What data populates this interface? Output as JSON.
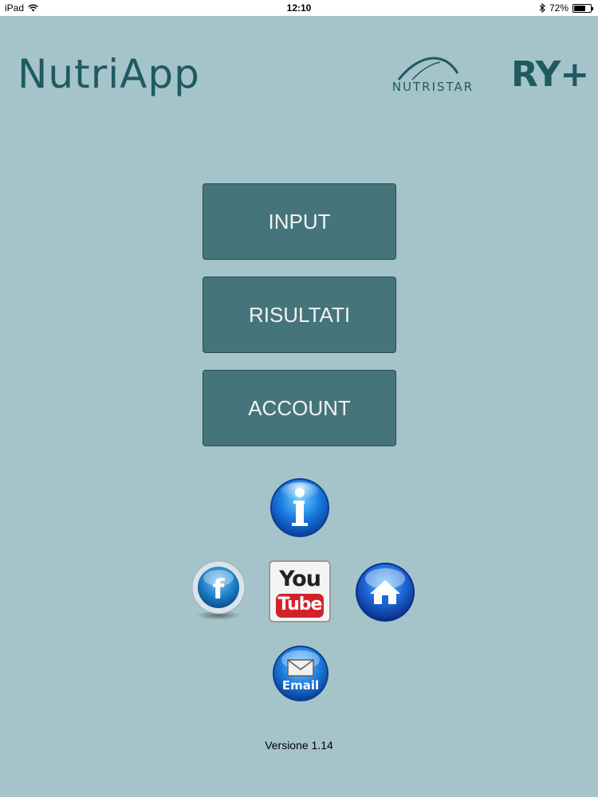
{
  "status_bar": {
    "device": "iPad",
    "time": "12:10",
    "battery_percent": "72%",
    "battery_level": 0.72,
    "icons": [
      "wifi-icon",
      "bluetooth-icon",
      "battery-icon"
    ]
  },
  "header": {
    "app_logo": "NutriApp",
    "partner_logo_1": "NUTRISTAR",
    "partner_logo_2": "RY+"
  },
  "menu": {
    "buttons": [
      {
        "label": "INPUT"
      },
      {
        "label": "RISULTATI"
      },
      {
        "label": "ACCOUNT"
      }
    ]
  },
  "social": {
    "info_icon": "info-icon",
    "facebook_icon": "facebook-icon",
    "youtube": {
      "top": "You",
      "bottom": "Tube"
    },
    "home_icon": "home-icon",
    "email_label": "Email"
  },
  "footer": {
    "version": "Versione 1.14"
  },
  "colors": {
    "background": "#a5c4c9",
    "button": "#45757b",
    "logo": "#1f5a62"
  }
}
